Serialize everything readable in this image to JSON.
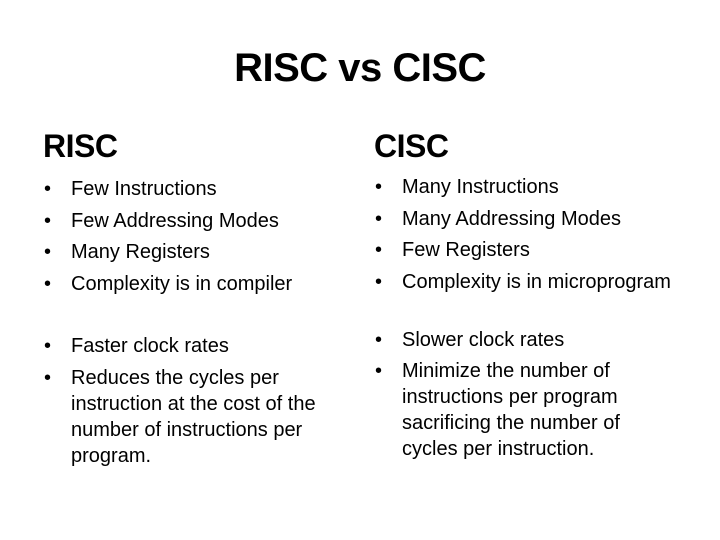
{
  "slide": {
    "title": "RISC vs CISC",
    "bullet_glyph": "•",
    "risc": {
      "heading": "RISC",
      "group1": [
        "Few Instructions",
        "Few Addressing Modes",
        "Many Registers",
        "Complexity is in compiler"
      ],
      "group2": [
        "Faster clock rates",
        "Reduces the cycles per instruction at the cost of the number of instructions per program."
      ]
    },
    "cisc": {
      "heading": "CISC",
      "group1": [
        "Many Instructions",
        "Many Addressing Modes",
        "Few Registers",
        "Complexity is in microprogram"
      ],
      "group2": [
        "Slower clock rates",
        "Minimize the number of instructions per program sacrificing the number of cycles per instruction."
      ]
    }
  }
}
